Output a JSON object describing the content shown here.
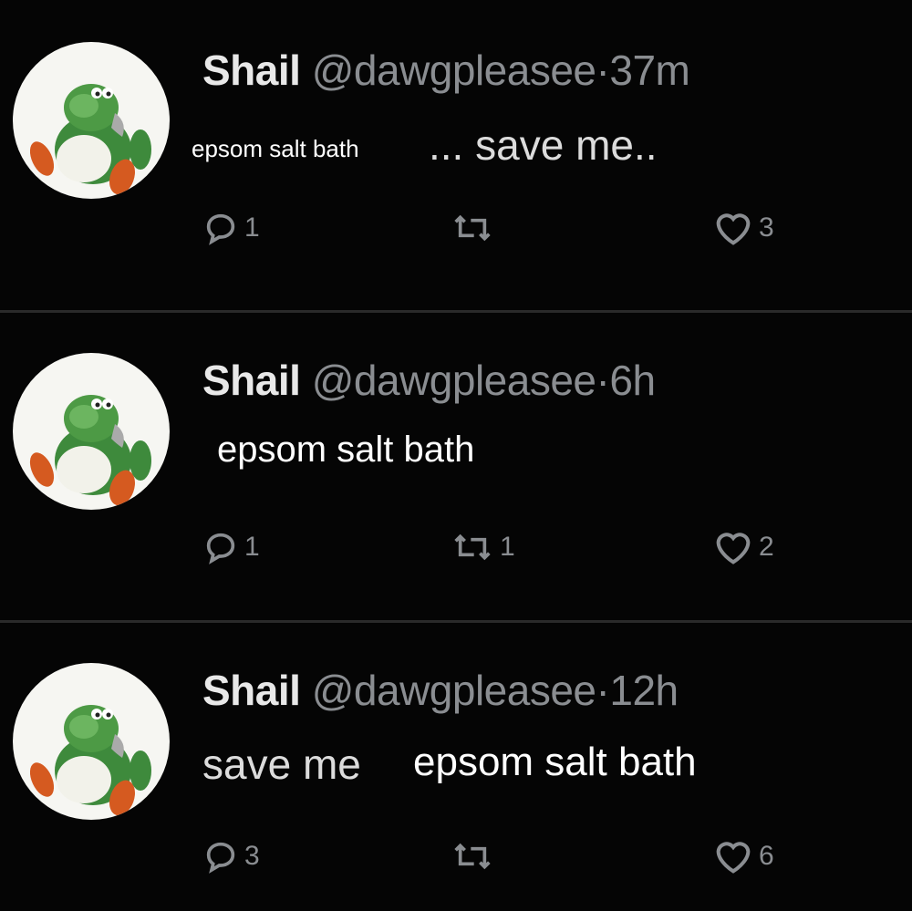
{
  "tweets": [
    {
      "name": "Shail",
      "handle": "@dawgpleasee",
      "separator": "·",
      "time": "37m",
      "caption_white": "epsom salt bath",
      "text_grey": "... save me..",
      "replies": "1",
      "retweets": "",
      "likes": "3"
    },
    {
      "name": "Shail",
      "handle": "@dawgpleasee",
      "separator": "·",
      "time": "6h",
      "text_white": "epsom salt bath",
      "replies": "1",
      "retweets": "1",
      "likes": "2"
    },
    {
      "name": "Shail",
      "handle": "@dawgpleasee",
      "separator": "·",
      "time": "12h",
      "text_grey": "save me",
      "text_white": "epsom salt bath",
      "replies": "3",
      "retweets": "",
      "likes": "6"
    }
  ],
  "icons": {
    "avatar": "green-dinosaur-avatar",
    "reply": "reply-icon",
    "retweet": "retweet-icon",
    "like": "heart-icon"
  },
  "colors": {
    "background": "#050505",
    "muted": "#8a8d91",
    "text": "#e7e7e7"
  }
}
